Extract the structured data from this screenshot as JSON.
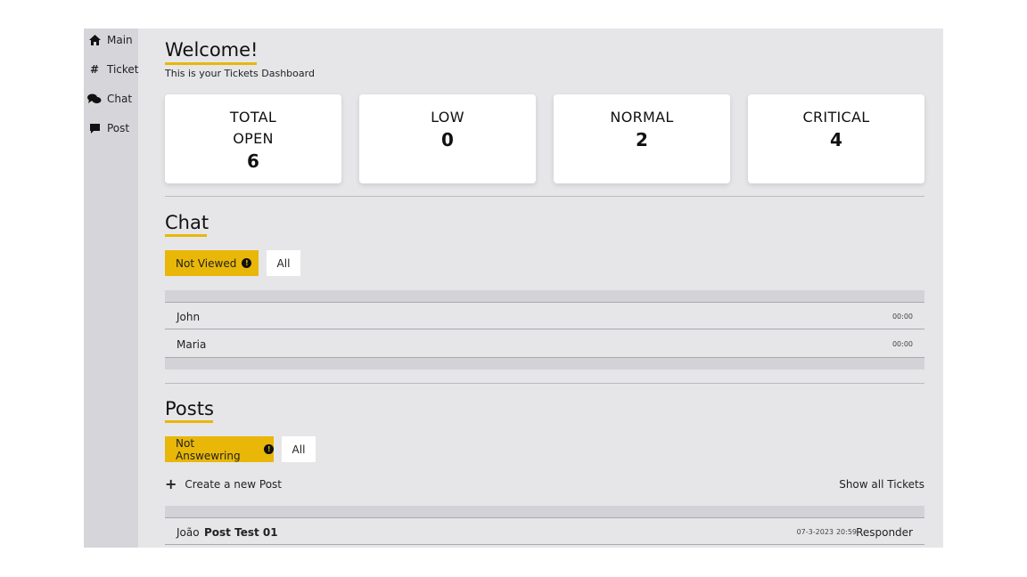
{
  "sidebar": {
    "items": [
      {
        "label": "Main",
        "icon": "home-icon"
      },
      {
        "label": "Ticket",
        "icon": "hash-icon"
      },
      {
        "label": "Chat",
        "icon": "chat-icon"
      },
      {
        "label": "Post",
        "icon": "comment-icon"
      }
    ]
  },
  "header": {
    "title": "Welcome!",
    "subtitle": "This is your Tickets Dashboard"
  },
  "stats": [
    {
      "label_line1": "TOTAL",
      "label_line2": "OPEN",
      "value": "6"
    },
    {
      "label_line1": "LOW",
      "label_line2": "",
      "value": "0"
    },
    {
      "label_line1": "NORMAL",
      "label_line2": "",
      "value": "2"
    },
    {
      "label_line1": "CRITICAL",
      "label_line2": "",
      "value": "4"
    }
  ],
  "chat": {
    "title": "Chat",
    "filter_active": "Not Viewed",
    "filter_all": "All",
    "rows": [
      {
        "name": "John",
        "time": "00:00"
      },
      {
        "name": "Maria",
        "time": "00:00"
      }
    ]
  },
  "posts": {
    "title": "Posts",
    "filter_active": "Not Answewring",
    "filter_all": "All",
    "create_label": "Create a new Post",
    "show_all_label": "Show all Tickets",
    "rows": [
      {
        "author": "João",
        "title": "Post Test 01",
        "date": "07-3-2023",
        "time": "20:59",
        "action": "Responder"
      }
    ]
  },
  "colors": {
    "accent": "#e8b708",
    "panel": "#e6e6e9",
    "sidebar": "#d6d6da"
  }
}
